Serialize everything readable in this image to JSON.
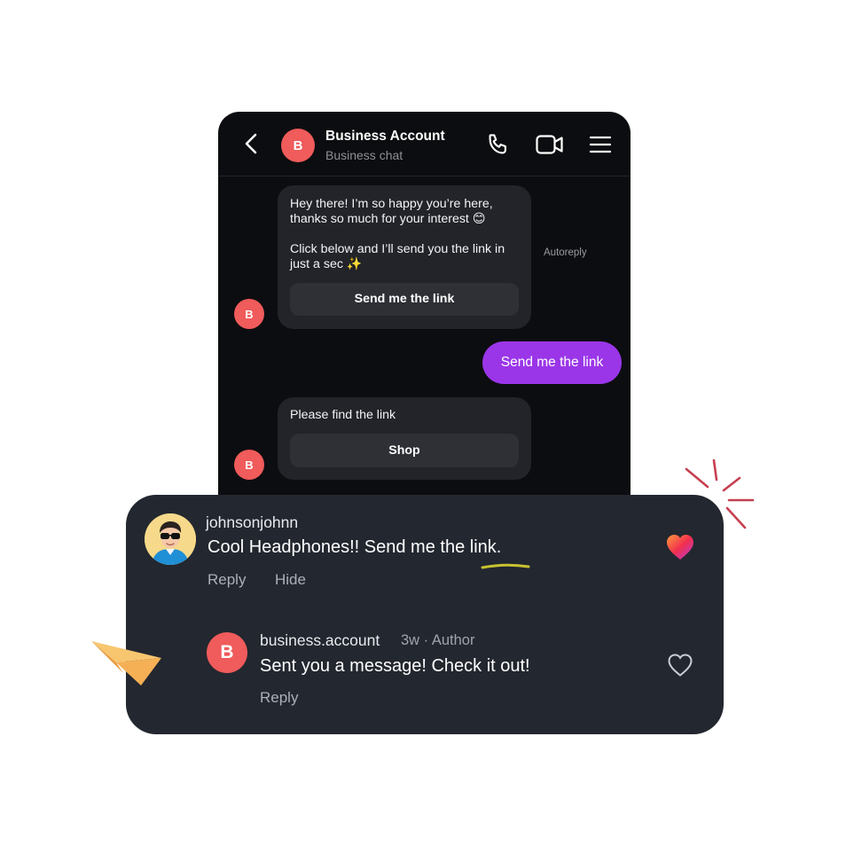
{
  "chat": {
    "header": {
      "avatar_letter": "B",
      "title": "Business Account",
      "subtitle": "Business chat",
      "icons": [
        "back-arrow-icon",
        "phone-icon",
        "video-icon",
        "menu-icon"
      ]
    },
    "messages": [
      {
        "text": "Hey there! I’m so happy you’re here, thanks so much for your interest 😊\n\nClick below and I’ll send you the link in just a sec ✨",
        "button": "Send me the link",
        "tag": "Autoreply",
        "avatar_letter": "B"
      },
      {
        "text": "Send me the link",
        "color": "#9a36e8"
      },
      {
        "text": "Please find the link",
        "button": "Shop",
        "avatar_letter": "B"
      }
    ]
  },
  "comments": {
    "first": {
      "username": "johnsonjohnn",
      "text": "Cool Headphones!! Send me the link.",
      "actions": [
        "Reply",
        "Hide"
      ],
      "liked": true
    },
    "reply": {
      "avatar_letter": "B",
      "username": "business.account",
      "meta": "3w · Author",
      "text": "Sent you a message! Check it out!",
      "action": "Reply",
      "liked": false
    }
  },
  "colors": {
    "accent_purple": "#9a36e8",
    "avatar_red": "#f05b5b",
    "underline_yellow": "#c9c230",
    "sparkle_red": "#c6404f",
    "paper_plane": "#f5b961"
  }
}
